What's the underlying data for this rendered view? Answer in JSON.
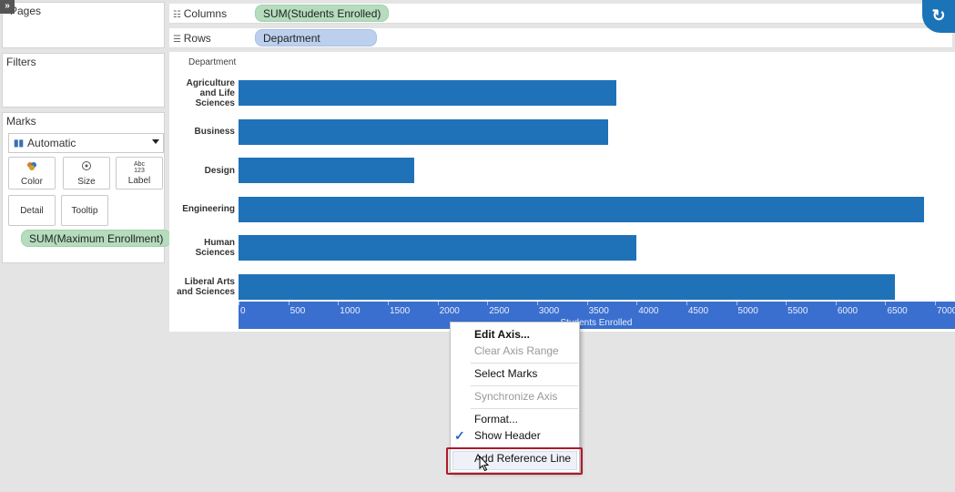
{
  "sidebar": {
    "pages_title": "Pages",
    "filters_title": "Filters",
    "marks_title": "Marks",
    "mark_type": "Automatic",
    "mark_buttons": [
      {
        "label": "Color",
        "icon": "color-icon"
      },
      {
        "label": "Size",
        "icon": "size-icon"
      },
      {
        "label": "Label",
        "icon": "label-icon",
        "icon_text": "Abc\n123"
      },
      {
        "label": "Detail",
        "icon": "detail-icon"
      },
      {
        "label": "Tooltip",
        "icon": "tooltip-icon"
      }
    ],
    "mark_pill": "SUM(Maximum Enrollment)"
  },
  "shelves": {
    "columns_label": "Columns",
    "columns_pill": "SUM(Students Enrolled)",
    "rows_label": "Rows",
    "rows_pill": "Department"
  },
  "chart_data": {
    "type": "bar",
    "orientation": "horizontal",
    "row_header": "Department",
    "categories": [
      "Agriculture and Life Sciences",
      "Business",
      "Design",
      "Engineering",
      "Human Sciences",
      "Liberal Arts and Sciences"
    ],
    "category_lines": [
      [
        "Agriculture",
        "and Life",
        "Sciences"
      ],
      [
        "Business"
      ],
      [
        "Design"
      ],
      [
        "Engineering"
      ],
      [
        "Human",
        "Sciences"
      ],
      [
        "Liberal Arts",
        "and Sciences"
      ]
    ],
    "values": [
      3800,
      3710,
      1770,
      6890,
      4000,
      6600
    ],
    "xlabel": "Students Enrolled",
    "xlim": [
      0,
      7200
    ],
    "xticks": [
      0,
      500,
      1000,
      1500,
      2000,
      2500,
      3000,
      3500,
      4000,
      4500,
      5000,
      5500,
      6000,
      6500,
      7000
    ],
    "bar_color": "#1f72b8",
    "axis_selected_color": "#3a6fcf"
  },
  "context_menu": {
    "items": [
      {
        "label": "Edit Axis...",
        "state": "bold"
      },
      {
        "label": "Clear Axis Range",
        "state": "disabled"
      },
      {
        "label": "Select Marks",
        "state": "normal"
      },
      {
        "label": "Synchronize Axis",
        "state": "disabled"
      },
      {
        "label": "Format...",
        "state": "normal"
      },
      {
        "label": "Show Header",
        "state": "checked"
      },
      {
        "label": "Add Reference Line",
        "state": "highlighted"
      }
    ],
    "highlight_color": "#b0182a"
  }
}
